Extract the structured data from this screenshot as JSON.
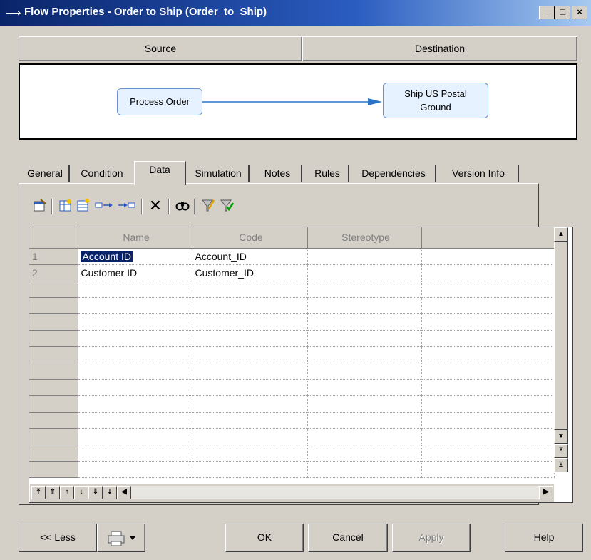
{
  "window": {
    "title": "Flow Properties - Order to Ship (Order_to_Ship)",
    "controls": {
      "minimize": "_",
      "maximize": "□",
      "close": "×"
    }
  },
  "header": {
    "source": "Source",
    "destination": "Destination"
  },
  "diagram": {
    "source_node": "Process Order",
    "dest_node_line1": "Ship US Postal",
    "dest_node_line2": "Ground"
  },
  "tabs": [
    {
      "label": "General"
    },
    {
      "label": "Condition"
    },
    {
      "label": "Data"
    },
    {
      "label": "Simulation"
    },
    {
      "label": "Notes"
    },
    {
      "label": "Rules"
    },
    {
      "label": "Dependencies"
    },
    {
      "label": "Version Info"
    }
  ],
  "active_tab": "Data",
  "toolbar": [
    "properties-icon",
    "add-data-icon",
    "new-row-icon",
    "insert-after-icon",
    "insert-before-icon",
    "delete-icon",
    "find-icon",
    "filter-icon",
    "customize-columns-icon"
  ],
  "grid": {
    "columns": [
      "Name",
      "Code",
      "Stereotype"
    ],
    "rows": [
      {
        "num": "1",
        "name": "Account ID",
        "code": "Account_ID",
        "stereotype": ""
      },
      {
        "num": "2",
        "name": "Customer ID",
        "code": "Customer_ID",
        "stereotype": ""
      }
    ]
  },
  "buttons": {
    "less": "<< Less",
    "ok": "OK",
    "cancel": "Cancel",
    "apply": "Apply",
    "help": "Help"
  }
}
